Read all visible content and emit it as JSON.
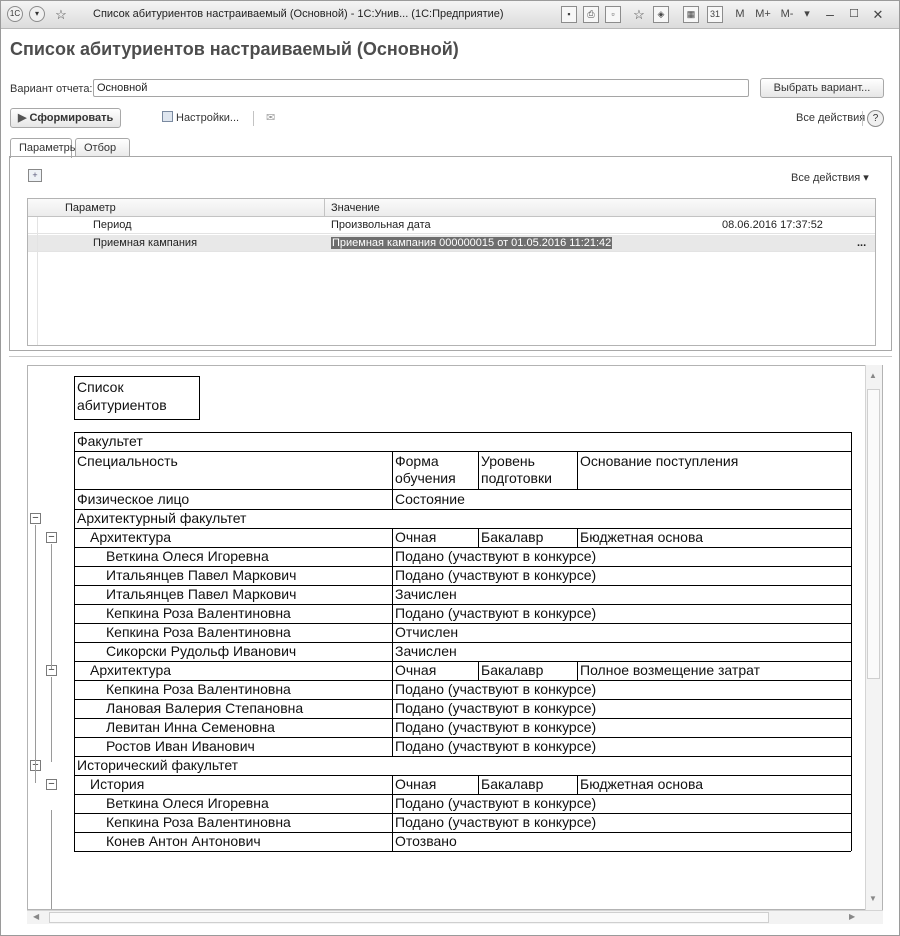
{
  "window": {
    "title": "Список абитуриентов настраиваемый (Основной) - 1С:Унив... (1С:Предприятие)",
    "toolbar_right": [
      "M",
      "M+",
      "M-"
    ]
  },
  "form": {
    "title": "Список абитуриентов настраиваемый (Основной)",
    "variant_label": "Вариант отчета:",
    "variant_value": "Основной",
    "choose_variant_button": "Выбрать вариант...",
    "generate_button": "Сформировать",
    "settings_button": "Настройки...",
    "all_actions": "Все действия ▾",
    "help": "?"
  },
  "tabs": [
    "Параметры",
    "Отбор"
  ],
  "params": {
    "all_actions": "Все действия ▾",
    "headers": [
      "Параметр",
      "Значение"
    ],
    "rows": [
      {
        "name": "Период",
        "value": "Произвольная дата",
        "extra": "08.06.2016 17:37:52"
      },
      {
        "name": "Приемная кампания",
        "value": "Приемная кампания 000000015 от 01.05.2016 11:21:42",
        "extra": "..."
      }
    ]
  },
  "report": {
    "title_line1": "Список",
    "title_line2": "абитуриентов",
    "header": {
      "faculty": "Факультет",
      "specialty": "Специальность",
      "form_line1": "Форма",
      "form_line2": "обучения",
      "level_line1": "Уровень",
      "level_line2": "подготовки",
      "basis": "Основание поступления",
      "person": "Физическое лицо",
      "state": "Состояние"
    },
    "rows": [
      {
        "kind": "faculty",
        "c1": "Архитектурный факультет"
      },
      {
        "kind": "spec",
        "c1": "Архитектура",
        "c2": "Очная",
        "c3": "Бакалавр",
        "c4": "Бюджетная основа"
      },
      {
        "kind": "person",
        "c1": "Веткина Олеся Игоревна",
        "c2": "Подано (участвуют в конкурсе)"
      },
      {
        "kind": "person",
        "c1": "Итальянцев Павел Маркович",
        "c2": "Подано (участвуют в конкурсе)",
        "boxed": true
      },
      {
        "kind": "person",
        "c1": "Итальянцев Павел Маркович",
        "c2": "Зачислен"
      },
      {
        "kind": "person",
        "c1": "Кепкина Роза Валентиновна",
        "c2": "Подано (участвуют в конкурсе)"
      },
      {
        "kind": "person",
        "c1": "Кепкина Роза Валентиновна",
        "c2": "Отчислен"
      },
      {
        "kind": "person",
        "c1": "Сикорски Рудольф Иванович",
        "c2": "Зачислен"
      },
      {
        "kind": "spec",
        "c1": "Архитектура",
        "c2": "Очная",
        "c3": "Бакалавр",
        "c4": "Полное возмещение затрат"
      },
      {
        "kind": "person",
        "c1": "Кепкина Роза Валентиновна",
        "c2": "Подано (участвуют в конкурсе)"
      },
      {
        "kind": "person",
        "c1": "Лановая Валерия Степановна",
        "c2": "Подано (участвуют в конкурсе)"
      },
      {
        "kind": "person",
        "c1": "Левитан Инна Семеновна",
        "c2": "Подано (участвуют в конкурсе)"
      },
      {
        "kind": "person",
        "c1": "Ростов Иван Иванович",
        "c2": "Подано (участвуют в конкурсе)"
      },
      {
        "kind": "faculty",
        "c1": "Исторический факультет"
      },
      {
        "kind": "spec",
        "c1": "История",
        "c2": "Очная",
        "c3": "Бакалавр",
        "c4": "Бюджетная основа"
      },
      {
        "kind": "person",
        "c1": "Веткина Олеся Игоревна",
        "c2": "Подано (участвуют в конкурсе)"
      },
      {
        "kind": "person",
        "c1": "Кепкина Роза Валентиновна",
        "c2": "Подано (участвуют в конкурсе)"
      },
      {
        "kind": "person",
        "c1": "Конев Антон Антонович",
        "c2": "Отозвано"
      }
    ]
  }
}
